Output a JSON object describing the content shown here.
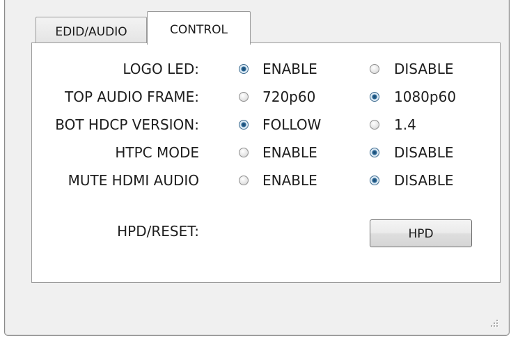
{
  "tabs": [
    {
      "label": "EDID/AUDIO",
      "selected": false
    },
    {
      "label": "CONTROL",
      "selected": true
    }
  ],
  "control": {
    "rows": [
      {
        "label": "LOGO LED:",
        "options": [
          "ENABLE",
          "DISABLE"
        ],
        "selected": "ENABLE"
      },
      {
        "label": "TOP AUDIO FRAME:",
        "options": [
          "720p60",
          "1080p60"
        ],
        "selected": "1080p60"
      },
      {
        "label": "BOT HDCP VERSION:",
        "options": [
          "FOLLOW",
          "1.4"
        ],
        "selected": "FOLLOW"
      },
      {
        "label": "HTPC MODE",
        "options": [
          "ENABLE",
          "DISABLE"
        ],
        "selected": "DISABLE"
      },
      {
        "label": "MUTE HDMI AUDIO",
        "options": [
          "ENABLE",
          "DISABLE"
        ],
        "selected": "DISABLE"
      }
    ],
    "hpd": {
      "label": "HPD/RESET:",
      "button_label": "HPD"
    }
  },
  "colors": {
    "radio_checked": "#2f6c9b",
    "window_background": "#f0f0f0",
    "panel_background": "#ffffff"
  },
  "icons": {
    "resize_grip": "resize-grip-icon"
  }
}
